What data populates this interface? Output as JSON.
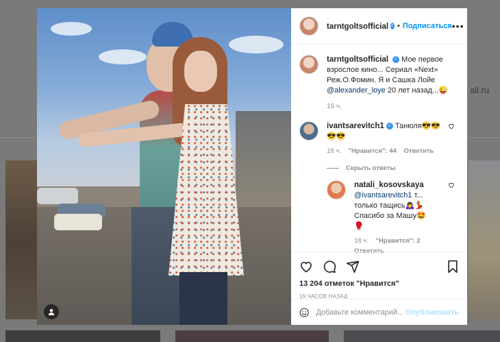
{
  "background": {
    "partial_text": "ail.ru"
  },
  "post": {
    "author": "tarntgoltsofficial",
    "follow_label": "Подписаться",
    "more_label": "•••",
    "verified_glyph": "✓"
  },
  "caption": {
    "author": "tarntgoltsofficial",
    "text": "Мое первое взрослое кино... Сериал «Next» Реж.О.Фомин. Я и Сашка Лойе",
    "mention": "@alexander_loye",
    "text_end": " 20 лет назад...😜",
    "time": "19 ч."
  },
  "comments": [
    {
      "author": "ivantsarevitch1",
      "text": "Танюля😎😎 😎😎",
      "time": "18 ч.",
      "likes": "\"Нравится\": 44",
      "reply_label": "Ответить"
    }
  ],
  "hide_replies_label": "Скрыть ответы",
  "reply": {
    "author": "natali_kosovskaya",
    "mention": "@ivantsarevitch1",
    "text": " т... только тащись🙇‍♀️💃 Спасибо за Машу🤩🥊",
    "time": "18 ч.",
    "likes": "\"Нравится\": 2",
    "reply_label": "Ответить"
  },
  "actions": {
    "likes_count": "13 204 отметок \"Нравится\"",
    "date": "19 ЧАСОВ НАЗАД"
  },
  "add_comment": {
    "placeholder": "Добавьте комментарий...",
    "publish_label": "Опубликовать"
  }
}
